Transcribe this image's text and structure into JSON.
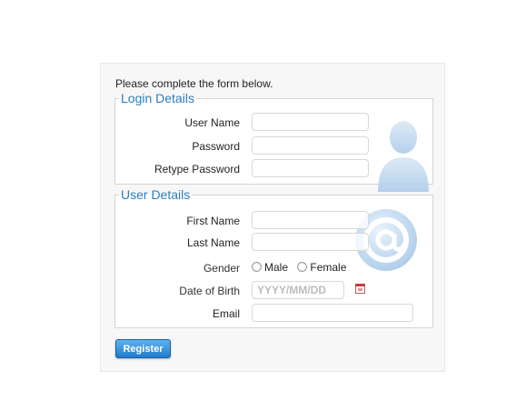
{
  "form": {
    "intro": "Please complete the form below.",
    "register_label": "Register"
  },
  "login": {
    "legend": "Login Details",
    "username_label": "User Name",
    "username_value": "",
    "password_label": "Password",
    "password_value": "",
    "retype_label": "Retype Password",
    "retype_value": ""
  },
  "user": {
    "legend": "User Details",
    "firstname_label": "First Name",
    "firstname_value": "",
    "lastname_label": "Last Name",
    "lastname_value": "",
    "gender_label": "Gender",
    "gender_options": [
      "Male",
      "Female"
    ],
    "dob_label": "Date of Birth",
    "dob_placeholder": "YYYY/MM/DD",
    "email_label": "Email",
    "email_value": ""
  },
  "icons": {
    "login_watermark": "user-silhouette-icon",
    "user_watermark": "at-sign-icon",
    "date_picker": "calendar-icon"
  },
  "colors": {
    "legend": "#2a7ec1",
    "button": "#2a86d4"
  }
}
